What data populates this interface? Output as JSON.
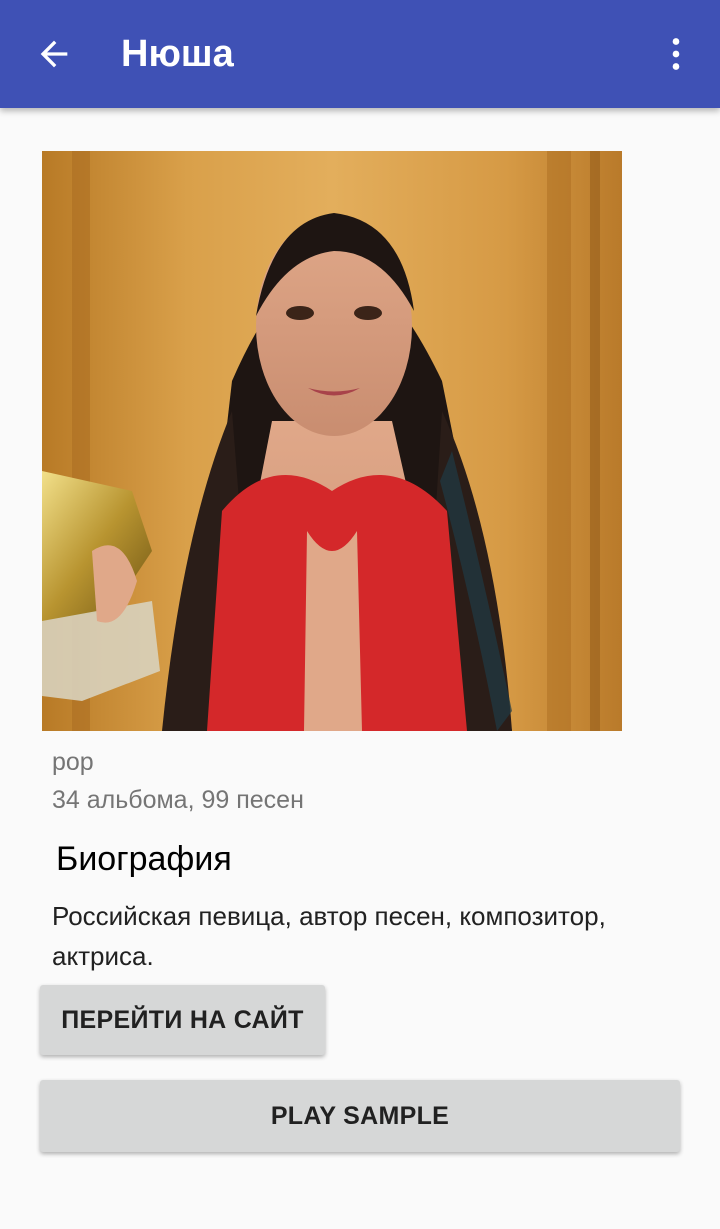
{
  "app_bar": {
    "title": "Нюша",
    "back_icon": "arrow-left-icon",
    "menu_icon": "more-vert-icon",
    "color": "#3f51b5"
  },
  "artist": {
    "photo_icon": "artist-photo",
    "genre": "pop",
    "stats": "34 альбома, 99 песен"
  },
  "biography": {
    "heading": "Биография",
    "text": "Российская певица, автор песен, композитор, актриса."
  },
  "buttons": {
    "website_label": "ПЕРЕЙТИ НА САЙТ",
    "play_label": "PLAY SAMPLE"
  }
}
